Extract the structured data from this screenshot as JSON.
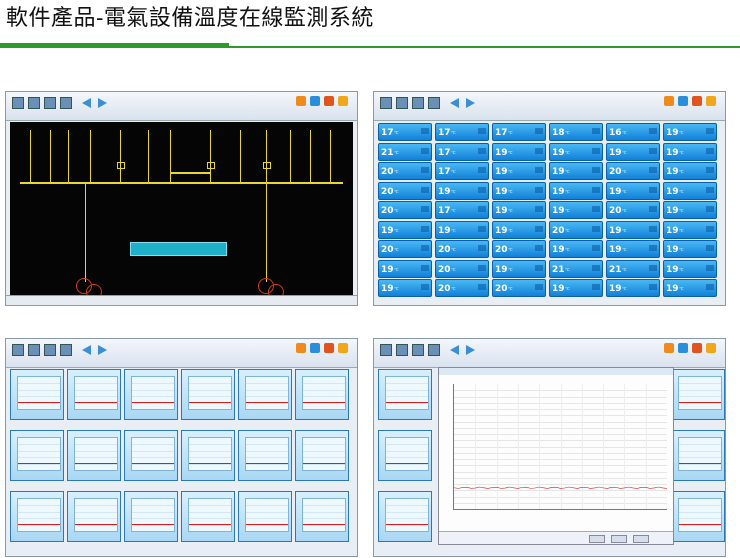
{
  "page": {
    "title": "軟件產品-電氣設備溫度在線監測系統"
  },
  "colors": {
    "accent_green": "#2e9a2e",
    "tile_blue": "#1a8ae0",
    "diagram_bg": "#050505",
    "line_yellow": "#e8d631",
    "trend_red": "#d02020"
  },
  "screens": [
    {
      "id": "wiring-diagram",
      "toolbar_icons": [
        "main-view-icon",
        "history-icon",
        "alarm-icon",
        "report-icon",
        "back-arrow-icon",
        "forward-arrow-icon"
      ]
    },
    {
      "id": "temperature-grid",
      "tile_values": [
        [
          "17",
          "17",
          "17",
          "18",
          "16",
          "19"
        ],
        [
          "21",
          "17",
          "19",
          "19",
          "19",
          "19"
        ],
        [
          "20",
          "17",
          "19",
          "19",
          "20",
          "19"
        ],
        [
          "20",
          "19",
          "19",
          "19",
          "19",
          "19"
        ],
        [
          "20",
          "17",
          "19",
          "19",
          "20",
          "19"
        ],
        [
          "19",
          "19",
          "19",
          "20",
          "19",
          "19"
        ],
        [
          "20",
          "20",
          "20",
          "19",
          "19",
          "19"
        ],
        [
          "19",
          "20",
          "19",
          "21",
          "21",
          "19"
        ],
        [
          "19",
          "20",
          "20",
          "19",
          "19",
          "19"
        ]
      ],
      "unit": "℃"
    },
    {
      "id": "trend-charts-grid"
    },
    {
      "id": "trend-chart-detail"
    }
  ]
}
